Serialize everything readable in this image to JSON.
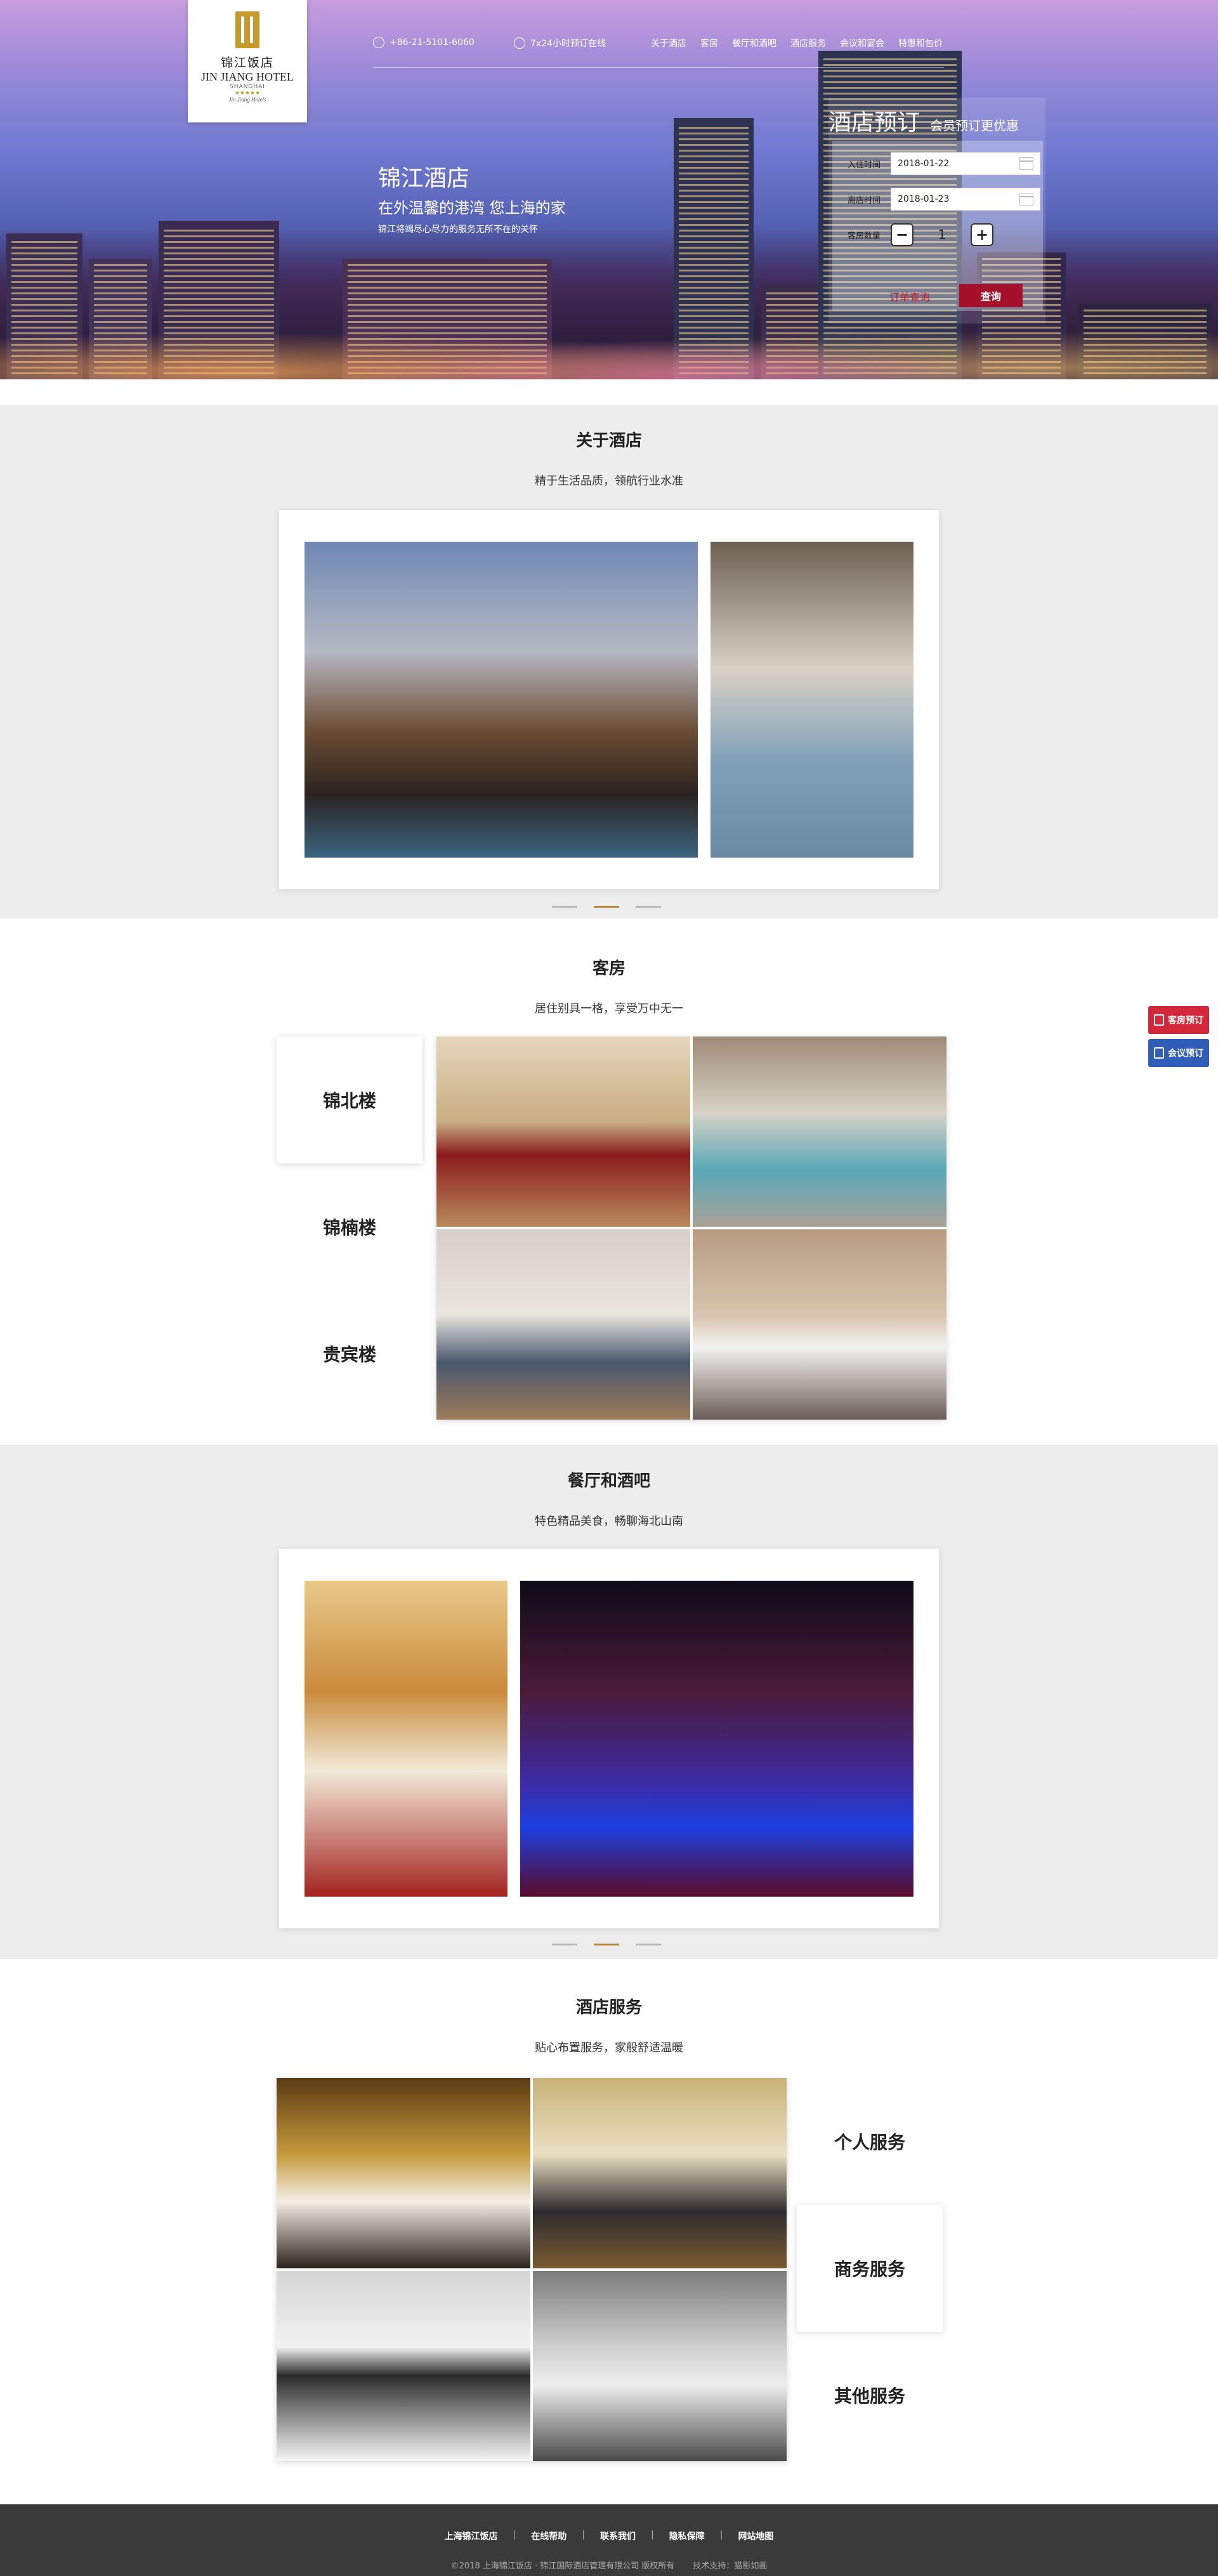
{
  "hero": {
    "logo": {
      "cn": "锦江饭店",
      "en": "JIN JIANG HOTEL",
      "sub": "SHANGHAI",
      "stars": "★★★★★",
      "brand": "Jin Jiang Hotels"
    },
    "phone": "+86-21-5101-6060",
    "service": "7x24小时预订在线",
    "nav": [
      "关于酒店",
      "客房",
      "餐厅和酒吧",
      "酒店服务",
      "会议和宴会",
      "特惠和包价"
    ],
    "headline": "锦江酒店",
    "subheadline": "在外温馨的港湾  您上海的家",
    "tagline": "锦江将竭尽心尽力的服务无所不在的关怀"
  },
  "booking": {
    "title": "酒店预订",
    "subtitle": "会员预订更优惠",
    "checkin": {
      "label": "入住时间",
      "value": "2018-01-22"
    },
    "checkout": {
      "label": "离店时间",
      "value": "2018-01-23"
    },
    "rooms": {
      "label": "客房数量",
      "value": "1",
      "minus": "−",
      "plus": "+"
    },
    "order_query": "订单查询",
    "search": "查询"
  },
  "about": {
    "title": "关于酒店",
    "subtitle": "精于生活品质，领航行业水准"
  },
  "rooms_section": {
    "title": "客房",
    "subtitle": "居住别具一格，享受万中无一",
    "tabs": [
      "锦北楼",
      "锦楠楼",
      "贵宾楼"
    ],
    "active_tab": 0
  },
  "dining": {
    "title": "餐厅和酒吧",
    "subtitle": "特色精品美食，畅聊海北山南"
  },
  "service_section": {
    "title": "酒店服务",
    "subtitle": "贴心布置服务，家般舒适温暖",
    "tabs": [
      "个人服务",
      "商务服务",
      "其他服务"
    ],
    "active_tab": 1
  },
  "carousel": {
    "active": 2,
    "count": 3
  },
  "footer": {
    "links": [
      "上海锦江饭店",
      "在线帮助",
      "联系我们",
      "隐私保障",
      "网站地图"
    ],
    "copyright": "©2018 上海锦江饭店 · 锦江国际酒店管理有限公司 版权所有",
    "tech": "技术支持：猫影如画"
  },
  "float": {
    "room_booking": "客房预订",
    "meeting_booking": "会议预订"
  },
  "colors": {
    "accent_red": "#a5112a",
    "gold": "#b58a3c",
    "float_red": "#d3283a",
    "float_blue": "#2f5db8"
  }
}
